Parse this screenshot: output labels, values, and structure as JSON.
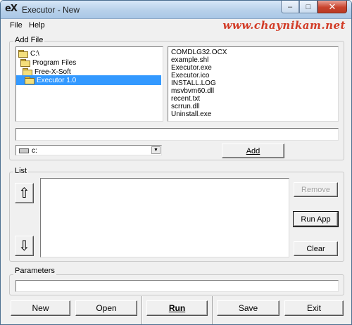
{
  "window": {
    "logo": "eX",
    "title": "Executor - New",
    "minimize_glyph": "–",
    "maximize_glyph": "□",
    "close_glyph": "✕",
    "watermark": "www.chaynikam.net"
  },
  "menu": [
    "File",
    "Help"
  ],
  "add_file": {
    "group_title": "Add File",
    "folders": [
      "C:\\",
      "Program Files",
      "Free-X-Soft",
      "Executor 1.0"
    ],
    "selected_folder": "Executor 1.0",
    "files": [
      "COMDLG32.OCX",
      "example.shl",
      "Executor.exe",
      "Executor.ico",
      "INSTALL.LOG",
      "msvbvm60.dll",
      "recent.txt",
      "scrrun.dll",
      "Uninstall.exe"
    ],
    "path_value": "",
    "drive": "c:",
    "add_button": "Add"
  },
  "list": {
    "group_title": "List",
    "items": [],
    "move_up_glyph": "⇧",
    "move_down_glyph": "⇩",
    "remove_button": "Remove",
    "run_app_button": "Run App",
    "clear_button": "Clear"
  },
  "parameters": {
    "group_title": "Parameters",
    "value": ""
  },
  "bottom": {
    "new": "New",
    "open": "Open",
    "run": "Run",
    "save": "Save",
    "exit": "Exit"
  },
  "icons": {
    "folder": "folder-icon",
    "drive": "drive-icon",
    "combo_arrow": "chevron-down-icon"
  }
}
